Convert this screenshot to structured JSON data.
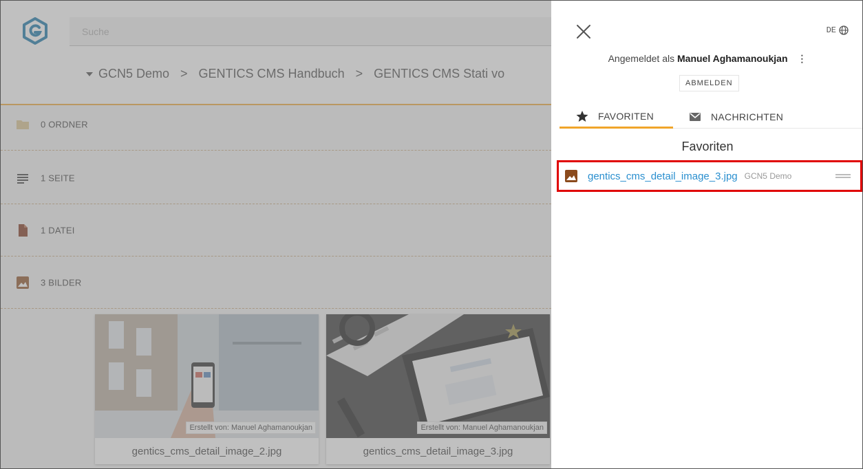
{
  "search": {
    "placeholder": "Suche"
  },
  "breadcrumb": {
    "items": [
      "GCN5 Demo",
      "GENTICS CMS Handbuch",
      "GENTICS CMS Stati vo"
    ],
    "separator": ">"
  },
  "sections": [
    {
      "label": "0 ORDNER",
      "icon": "folder-icon"
    },
    {
      "label": "1 SEITE",
      "icon": "page-lines-icon"
    },
    {
      "label": "1 DATEI",
      "icon": "file-icon"
    },
    {
      "label": "3 BILDER",
      "icon": "image-icon"
    }
  ],
  "cards": [
    {
      "caption": "gentics_cms_detail_image_2.jpg",
      "creator": "Erstellt von: Manuel Aghamanoukjan"
    },
    {
      "caption": "gentics_cms_detail_image_3.jpg",
      "creator": "Erstellt von: Manuel Aghamanoukjan"
    }
  ],
  "panel": {
    "lang": "DE",
    "logged_in_prefix": "Angemeldet als",
    "username": "Manuel Aghamanoukjan",
    "logout_label": "ABMELDEN",
    "tabs": [
      {
        "label": "FAVORITEN",
        "icon": "star-icon"
      },
      {
        "label": "NACHRICHTEN",
        "icon": "envelope-icon"
      }
    ],
    "favorites_title": "Favoriten",
    "favorites": [
      {
        "name": "gentics_cms_detail_image_3.jpg",
        "node": "GCN5 Demo",
        "icon": "image-icon"
      }
    ]
  },
  "colors": {
    "accent": "#f0a52a",
    "link": "#2a8fcf",
    "highlight_border": "#e00000",
    "image_icon": "#8b4a1c"
  }
}
